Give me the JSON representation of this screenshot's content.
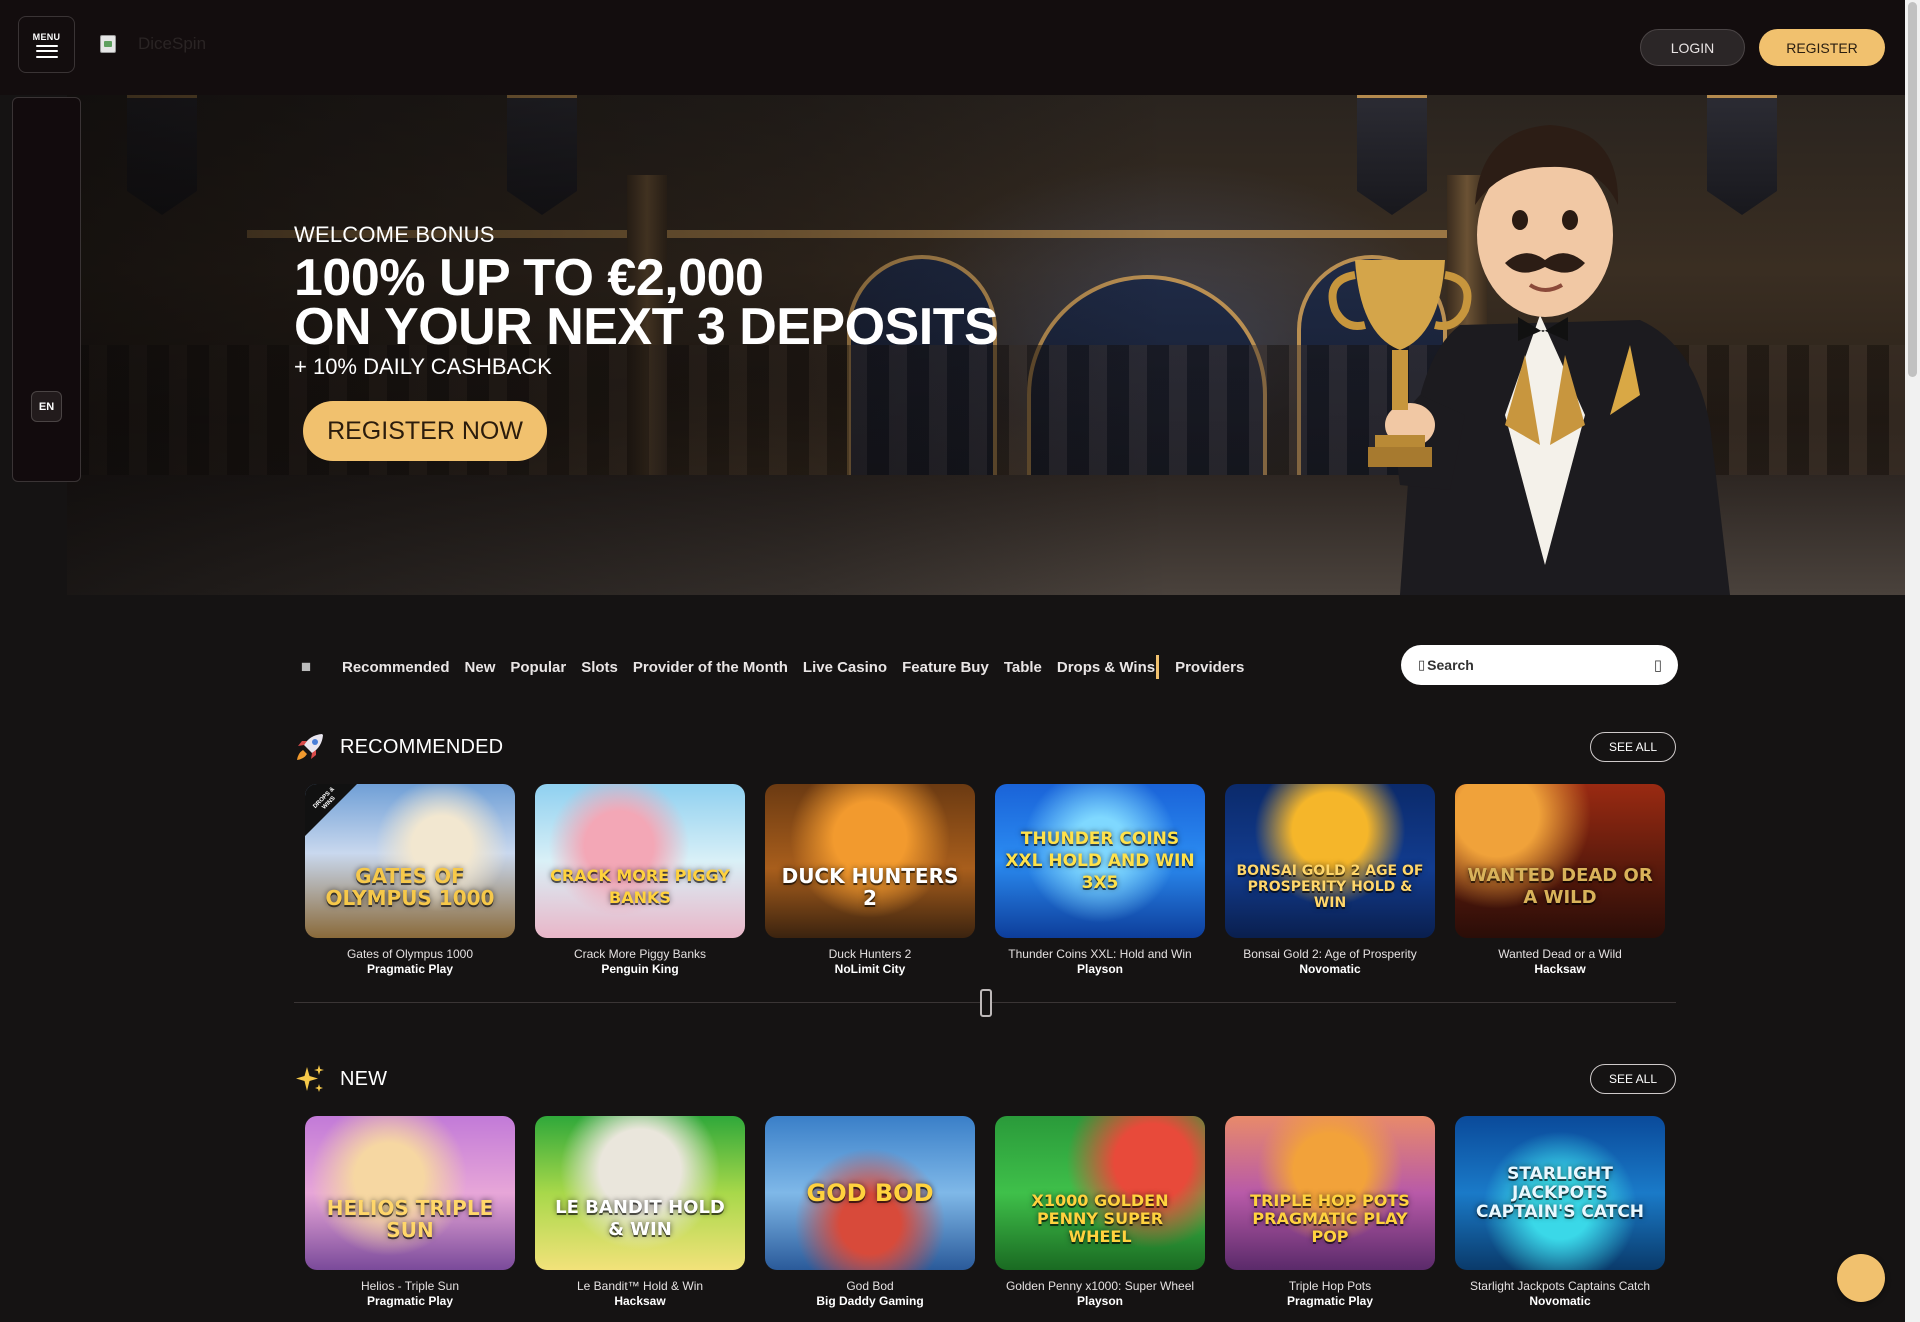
{
  "header": {
    "menu_label": "MENU",
    "logo_text": "DiceSpin",
    "login_label": "LOGIN",
    "register_label": "REGISTER"
  },
  "side_panel": {
    "language": "EN"
  },
  "hero": {
    "eyebrow": "WELCOME BONUS",
    "title_line1": "100% UP TO €2,000",
    "title_line2": "ON YOUR NEXT 3 DEPOSITS",
    "subtitle": "+ 10% DAILY CASHBACK",
    "cta_label": "REGISTER NOW"
  },
  "category_nav": {
    "items": [
      "Recommended",
      "New",
      "Popular",
      "Slots",
      "Provider of the Month",
      "Live Casino",
      "Feature Buy",
      "Table",
      "Drops & Wins"
    ],
    "providers_label": "Providers"
  },
  "search": {
    "placeholder": "Search"
  },
  "sections": [
    {
      "title": "RECOMMENDED",
      "icon": "rocket-icon",
      "see_all": "SEE ALL",
      "games": [
        {
          "name": "Gates of Olympus 1000",
          "provider": "Pragmatic Play",
          "art_text": "Gates of Olympus 1000",
          "badge": "DROPS & WINS"
        },
        {
          "name": "Crack More Piggy Banks",
          "provider": "Penguin King",
          "art_text": "Crack More Piggy Banks"
        },
        {
          "name": "Duck Hunters 2",
          "provider": "NoLimit City",
          "art_text": "Duck Hunters 2"
        },
        {
          "name": "Thunder Coins XXL: Hold and Win",
          "provider": "Playson",
          "art_text": "Thunder Coins XXL Hold and Win 3x5"
        },
        {
          "name": "Bonsai Gold 2: Age of Prosperity",
          "provider": "Novomatic",
          "art_text": "Bonsai Gold 2 Age of Prosperity Hold & Win"
        },
        {
          "name": "Wanted Dead or a Wild",
          "provider": "Hacksaw",
          "art_text": "Wanted Dead or a Wild"
        }
      ]
    },
    {
      "title": "NEW",
      "icon": "sparkles-icon",
      "see_all": "SEE ALL",
      "games": [
        {
          "name": "Helios - Triple Sun",
          "provider": "Pragmatic Play",
          "art_text": "Helios Triple Sun"
        },
        {
          "name": "Le Bandit™ Hold & Win",
          "provider": "Hacksaw",
          "art_text": "Le Bandit Hold & Win"
        },
        {
          "name": "God Bod",
          "provider": "Big Daddy Gaming",
          "art_text": "God Bod"
        },
        {
          "name": "Golden Penny x1000: Super Wheel",
          "provider": "Playson",
          "art_text": "x1000 Golden Penny Super Wheel"
        },
        {
          "name": "Triple Hop Pots",
          "provider": "Pragmatic Play",
          "art_text": "Triple Hop Pots Pragmatic Play Pop"
        },
        {
          "name": "Starlight Jackpots Captains Catch",
          "provider": "Novomatic",
          "art_text": "Starlight Jackpots Captain's Catch"
        }
      ]
    }
  ],
  "colors": {
    "background": "#151313",
    "header": "#130d0e",
    "accent_gold": "#f1c16e"
  }
}
